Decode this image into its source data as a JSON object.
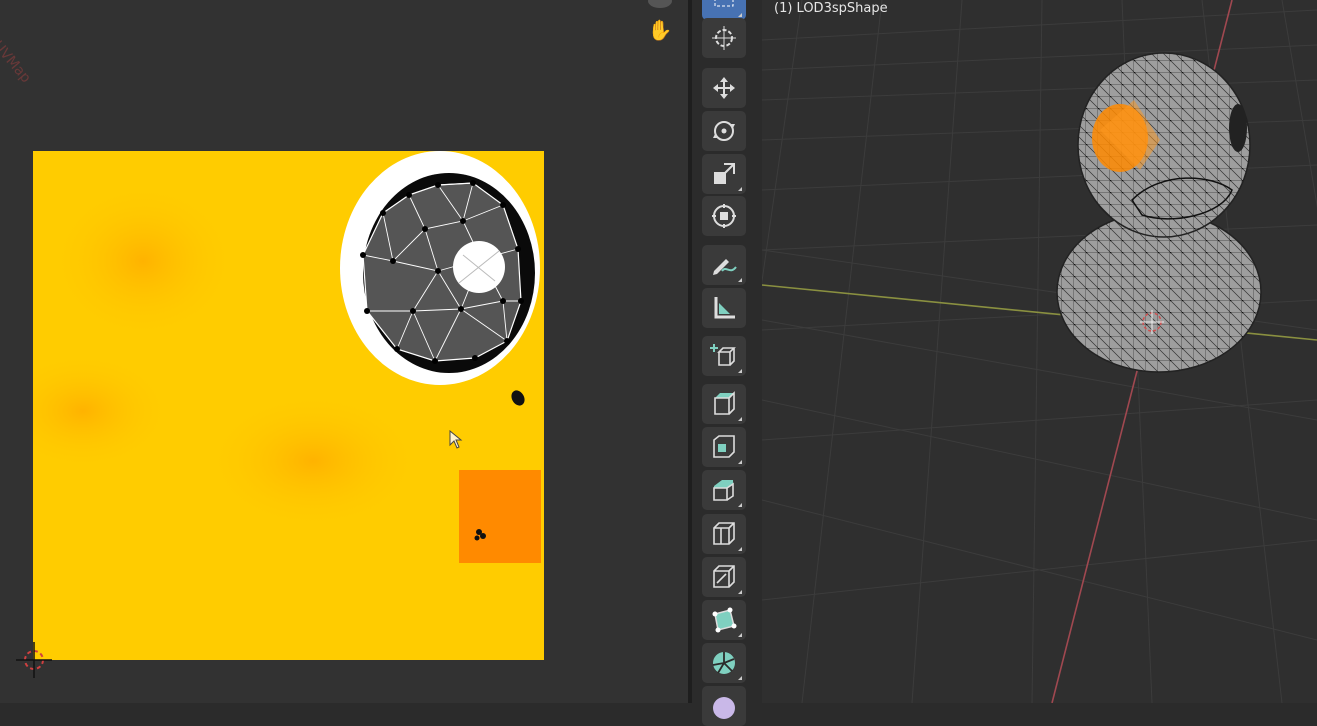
{
  "uv_editor": {
    "corner_text": "UVMap",
    "texture_colors": {
      "base": "#ffcc00",
      "shade": "#ffb700",
      "orange_patch": "#ff8a00",
      "eye_white": "#ffffff",
      "eye_black": "#0a0a0a"
    },
    "uv_wire_color": "#ffffff"
  },
  "toolbar": {
    "tools": [
      {
        "name": "select-box",
        "icon": "select-box-icon",
        "active": true
      },
      {
        "name": "cursor",
        "icon": "cursor-icon"
      },
      {
        "name": "move",
        "icon": "move-icon"
      },
      {
        "name": "rotate",
        "icon": "rotate-icon"
      },
      {
        "name": "scale",
        "icon": "scale-icon"
      },
      {
        "name": "transform",
        "icon": "transform-icon"
      },
      {
        "name": "annotate",
        "icon": "annotate-icon"
      },
      {
        "name": "measure",
        "icon": "measure-icon"
      },
      {
        "name": "add-cube",
        "icon": "add-cube-icon"
      },
      {
        "name": "extrude-region",
        "icon": "extrude-icon"
      },
      {
        "name": "inset-faces",
        "icon": "inset-icon"
      },
      {
        "name": "bevel",
        "icon": "bevel-icon"
      },
      {
        "name": "loop-cut",
        "icon": "loop-cut-icon"
      },
      {
        "name": "knife",
        "icon": "knife-icon"
      },
      {
        "name": "poly-build",
        "icon": "poly-build-icon"
      },
      {
        "name": "spin",
        "icon": "spin-icon"
      },
      {
        "name": "smooth",
        "icon": "smooth-icon"
      }
    ]
  },
  "viewport": {
    "object_label": "(1) LOD3spShape",
    "x_axis_color": "#9aa040",
    "y_axis_color": "#a04850",
    "selection_color": "#ff8a00"
  }
}
